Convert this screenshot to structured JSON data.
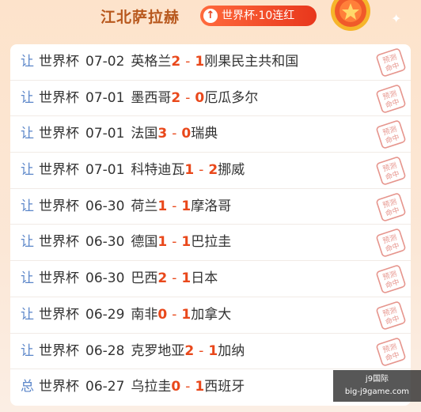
{
  "header": {
    "name": "江北萨拉赫",
    "streak_label": "世界杯·10连红",
    "arrow_glyph": "↑"
  },
  "stamp_text": [
    "预测",
    "命中"
  ],
  "rows": [
    {
      "kind": "让",
      "comp": "世界杯",
      "date": "07-02",
      "home": "英格兰",
      "hs": "2",
      "as": "1",
      "away": "刚果民主共和国"
    },
    {
      "kind": "让",
      "comp": "世界杯",
      "date": "07-01",
      "home": "墨西哥",
      "hs": "2",
      "as": "0",
      "away": "厄瓜多尔"
    },
    {
      "kind": "让",
      "comp": "世界杯",
      "date": "07-01",
      "home": "法国",
      "hs": "3",
      "as": "0",
      "away": "瑞典"
    },
    {
      "kind": "让",
      "comp": "世界杯",
      "date": "07-01",
      "home": "科特迪瓦",
      "hs": "1",
      "as": "2",
      "away": "挪威"
    },
    {
      "kind": "让",
      "comp": "世界杯",
      "date": "06-30",
      "home": "荷兰",
      "hs": "1",
      "as": "1",
      "away": "摩洛哥"
    },
    {
      "kind": "让",
      "comp": "世界杯",
      "date": "06-30",
      "home": "德国",
      "hs": "1",
      "as": "1",
      "away": "巴拉圭"
    },
    {
      "kind": "让",
      "comp": "世界杯",
      "date": "06-30",
      "home": "巴西",
      "hs": "2",
      "as": "1",
      "away": "日本"
    },
    {
      "kind": "让",
      "comp": "世界杯",
      "date": "06-29",
      "home": "南非",
      "hs": "0",
      "as": "1",
      "away": "加拿大"
    },
    {
      "kind": "让",
      "comp": "世界杯",
      "date": "06-28",
      "home": "克罗地亚",
      "hs": "2",
      "as": "1",
      "away": "加纳"
    },
    {
      "kind": "总",
      "comp": "世界杯",
      "date": "06-27",
      "home": "乌拉圭",
      "hs": "0",
      "as": "1",
      "away": "西班牙"
    }
  ],
  "watermark": {
    "line1": "j9国际",
    "line2": "big-j9game.com"
  },
  "colors": {
    "score": "#e9481b",
    "kind": "#5b86c9",
    "title": "#b8581d",
    "badge": "#e8371c"
  }
}
